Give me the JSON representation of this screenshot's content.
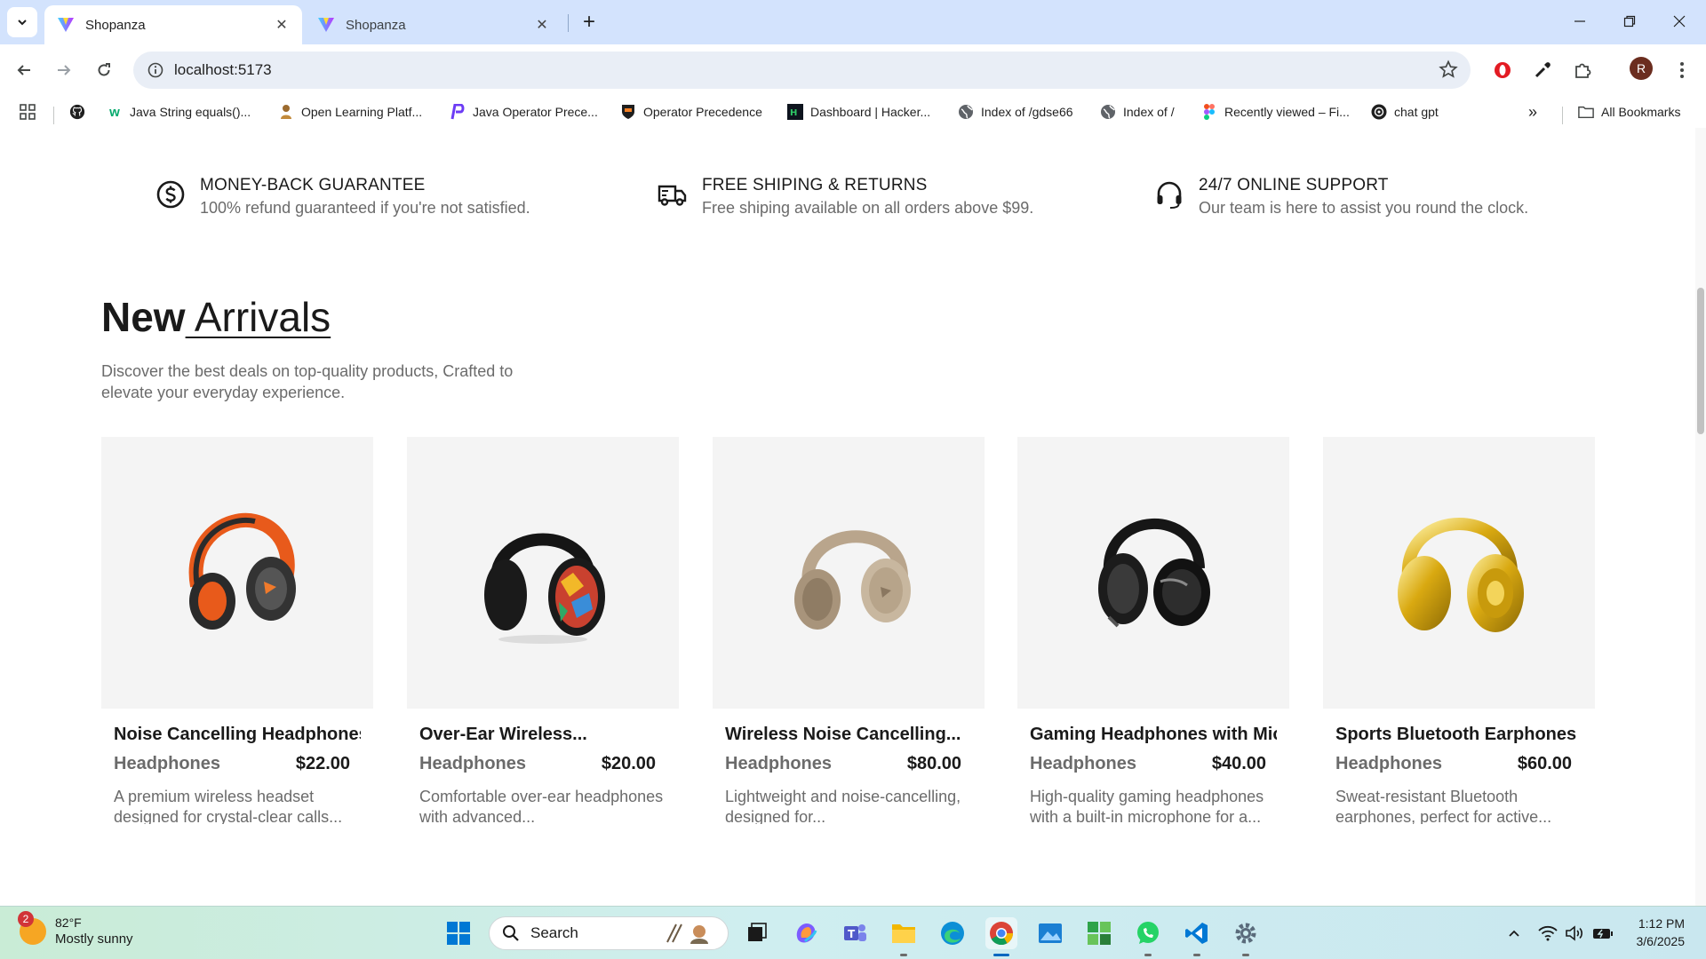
{
  "browser": {
    "tabs": [
      {
        "title": "Shopanza",
        "active": true
      },
      {
        "title": "Shopanza",
        "active": false
      }
    ],
    "url": "localhost:5173",
    "profile_initial": "R",
    "bookmarks": [
      {
        "label": "",
        "icon": "github-icon"
      },
      {
        "label": "Java String equals()...",
        "icon": "w3-icon"
      },
      {
        "label": "Open Learning Platf...",
        "icon": "learning-icon"
      },
      {
        "label": "Java Operator Prece...",
        "icon": "p-logo-icon"
      },
      {
        "label": "Operator Precedence",
        "icon": "princeton-icon"
      },
      {
        "label": "Dashboard | Hacker...",
        "icon": "hackerrank-icon"
      },
      {
        "label": "Index of /gdse66",
        "icon": "globe-icon"
      },
      {
        "label": "Index of /",
        "icon": "globe-icon"
      },
      {
        "label": "Recently viewed – Fi...",
        "icon": "figma-icon"
      },
      {
        "label": "chat gpt",
        "icon": "openai-icon"
      }
    ],
    "all_bookmarks_label": "All Bookmarks"
  },
  "features": [
    {
      "title": "MONEY-BACK GUARANTEE",
      "text": "100% refund guaranteed if you're not satisfied.",
      "icon": "dollar-circle-icon"
    },
    {
      "title": "FREE SHIPING & RETURNS",
      "text": "Free shiping available on all orders above $99.",
      "icon": "truck-icon"
    },
    {
      "title": "24/7 ONLINE SUPPORT",
      "text": "Our team is here to assist you round the clock.",
      "icon": "headset-icon"
    }
  ],
  "new_arrivals": {
    "title_bold": "New",
    "title_underlined": " Arrivals",
    "subtitle": "Discover the best deals on top-quality products, Crafted to elevate your everyday experience."
  },
  "products": [
    {
      "name": "Noise Cancelling Headphones",
      "category": "Headphones",
      "price": "$22.00",
      "description": "A premium wireless headset designed for crystal-clear calls..."
    },
    {
      "name": "Over-Ear Wireless...",
      "category": "Headphones",
      "price": "$20.00",
      "description": "Comfortable over-ear headphones with advanced..."
    },
    {
      "name": "Wireless Noise Cancelling...",
      "category": "Headphones",
      "price": "$80.00",
      "description": "Lightweight and noise-cancelling, designed for..."
    },
    {
      "name": "Gaming Headphones with Mic",
      "category": "Headphones",
      "price": "$40.00",
      "description": "High-quality gaming headphones with a built-in microphone for a..."
    },
    {
      "name": "Sports Bluetooth Earphones",
      "category": "Headphones",
      "price": "$60.00",
      "description": "Sweat-resistant Bluetooth earphones, perfect for active..."
    }
  ],
  "taskbar": {
    "weather_temp": "82°F",
    "weather_desc": "Mostly sunny",
    "weather_badge": "2",
    "search_label": "Search",
    "time": "1:12 PM",
    "date": "3/6/2025"
  },
  "colors": {
    "tabstrip": "#d3e3fd",
    "card_bg": "#f4f4f4",
    "text_muted": "#6b6b6b",
    "text_dark": "#1a1a1a"
  }
}
